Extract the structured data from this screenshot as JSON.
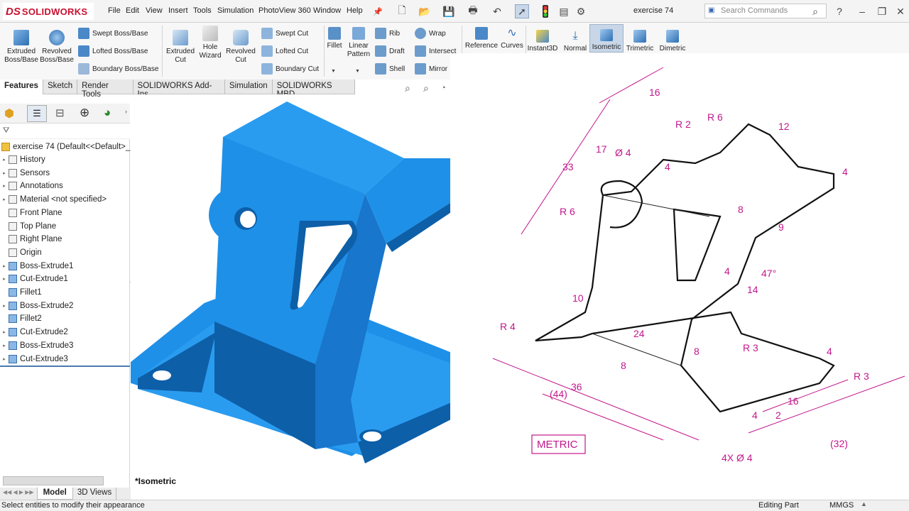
{
  "app": {
    "logo_ds": "DS",
    "logo_text": "SOLIDWORKS",
    "doc_name": "exercise 74"
  },
  "menu": [
    "File",
    "Edit",
    "View",
    "Insert",
    "Tools",
    "Simulation",
    "PhotoView 360",
    "Window",
    "Help"
  ],
  "search": {
    "placeholder": "Search Commands"
  },
  "ribbon": {
    "extruded_boss": [
      "Extruded",
      "Boss/Base"
    ],
    "revolved_boss": [
      "Revolved",
      "Boss/Base"
    ],
    "swept_boss": "Swept Boss/Base",
    "lofted_boss": "Lofted Boss/Base",
    "boundary_boss": "Boundary Boss/Base",
    "extruded_cut": [
      "Extruded",
      "Cut"
    ],
    "hole_wizard": [
      "Hole",
      "Wizard"
    ],
    "revolved_cut": [
      "Revolved",
      "Cut"
    ],
    "swept_cut": "Swept Cut",
    "lofted_cut": "Lofted Cut",
    "boundary_cut": "Boundary Cut",
    "fillet": "Fillet",
    "linear_pattern": [
      "Linear",
      "Pattern"
    ],
    "rib": "Rib",
    "draft": "Draft",
    "shell": "Shell",
    "wrap": "Wrap",
    "intersect": "Intersect",
    "mirror": "Mirror",
    "reference": "Reference",
    "curves": "Curves",
    "instant3d": "Instant3D",
    "normal": "Normal",
    "isometric": "Isometric",
    "trimetric": "Trimetric",
    "dimetric": "Dimetric"
  },
  "tabs": [
    "Features",
    "Sketch",
    "Render Tools",
    "SOLIDWORKS Add-Ins",
    "Simulation",
    "SOLIDWORKS MBD"
  ],
  "tree": {
    "root": "exercise 74  (Default<<Default>_",
    "items": [
      "History",
      "Sensors",
      "Annotations",
      "Material <not specified>",
      "Front Plane",
      "Top Plane",
      "Right Plane",
      "Origin",
      "Boss-Extrude1",
      "Cut-Extrude1",
      "Fillet1",
      "Boss-Extrude2",
      "Fillet2",
      "Cut-Extrude2",
      "Boss-Extrude3",
      "Cut-Extrude3"
    ]
  },
  "viewport": {
    "view_label": "*Isometric"
  },
  "bottom_tabs": [
    "Model",
    "3D Views"
  ],
  "status": {
    "message": "Select entities to modify their appearance",
    "mode": "Editing Part",
    "units": "MMGS"
  },
  "drawing": {
    "metric_label": "METRIC",
    "dims": [
      "16",
      "R 6",
      "12",
      "R 2",
      "33",
      "17",
      "Ø 4",
      "4",
      "4",
      "R 6",
      "8",
      "9",
      "47°",
      "4",
      "14",
      "10",
      "R 4",
      "24",
      "8",
      "8",
      "R 3",
      "4",
      "R 3",
      "36",
      "(44)",
      "16",
      "2",
      "4",
      "(32)",
      "4X Ø 4"
    ]
  },
  "colors": {
    "part_blue": "#1e90e8",
    "part_dark": "#0d5fa8",
    "dim_magenta": "#c2178c",
    "accent_red": "#c8102e"
  }
}
